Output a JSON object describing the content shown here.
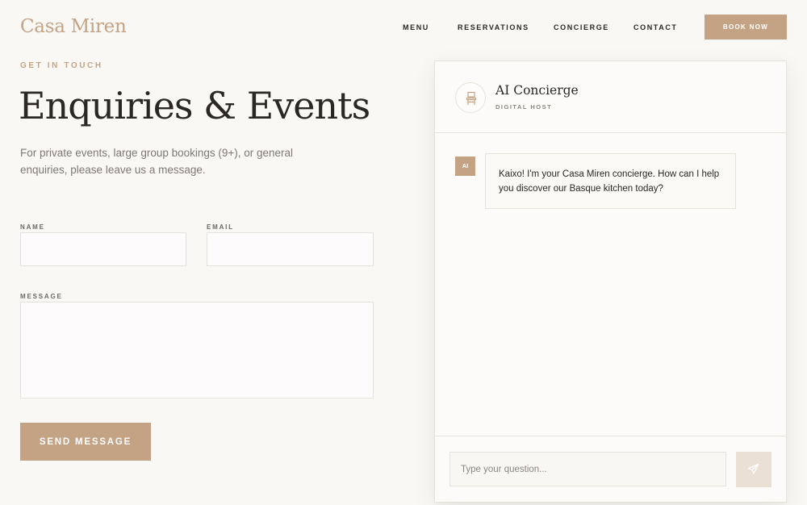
{
  "header": {
    "brand": "Casa Miren",
    "nav": [
      {
        "label": "MENU"
      },
      {
        "label": "RESERVATIONS"
      },
      {
        "label": "CONCIERGE"
      },
      {
        "label": "CONTACT"
      }
    ],
    "cta_label": "BOOK NOW"
  },
  "contact": {
    "eyebrow": "GET IN TOUCH",
    "title": "Enquiries & Events",
    "intro": "For private events, large group bookings (9+), or general enquiries, please leave us a message.",
    "name_label": "NAME",
    "name_value": "",
    "email_label": "EMAIL",
    "email_value": "",
    "message_label": "MESSAGE",
    "message_value": "",
    "submit_label": "SEND MESSAGE"
  },
  "concierge": {
    "avatar_icon": "chair-icon",
    "title": "AI Concierge",
    "subtitle": "DIGITAL HOST",
    "messages": [
      {
        "sender_badge": "AI",
        "text": "Kaixo! I'm your Casa Miren concierge. How can I help you discover our Basque kitchen today?"
      }
    ],
    "input_placeholder": "Type your question...",
    "send_icon": "send-icon"
  },
  "colors": {
    "accent": "#c4a385",
    "background": "#faf8f5",
    "text": "#2a2725",
    "muted": "#7d7873",
    "border": "#e7e2dc"
  }
}
